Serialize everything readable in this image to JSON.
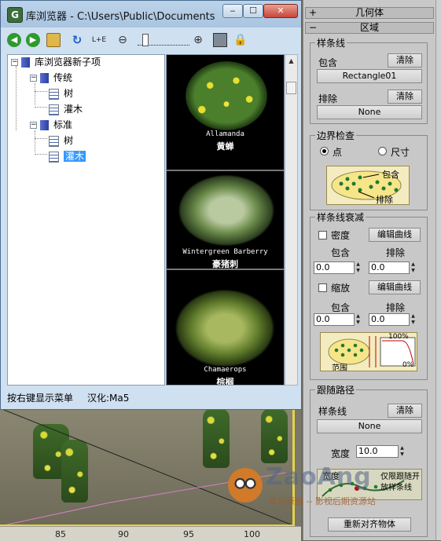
{
  "window": {
    "title": "库浏览器 - C:\\Users\\Public\\Documents\\t...",
    "app_icon": "G",
    "controls": {
      "minimize": "‒",
      "maximize": "☐",
      "close": "✕"
    }
  },
  "toolbar": {
    "icons": [
      "back-icon",
      "forward-icon",
      "folder-up-icon",
      "refresh-icon",
      "le-icon",
      "zoom-out-icon",
      "zoom-slider",
      "zoom-in-icon",
      "save-icon",
      "lock-icon"
    ],
    "le_label": "L+E"
  },
  "tree": {
    "root": "库浏览器新子项",
    "groups": [
      {
        "label": "传统",
        "items": [
          "树",
          "灌木"
        ]
      },
      {
        "label": "标准",
        "items": [
          "树",
          "灌木"
        ]
      }
    ],
    "selected": "灌木"
  },
  "preview": {
    "items": [
      {
        "name_en": "Allamanda",
        "name_cn": "黄蝉"
      },
      {
        "name_en": "Wintergreen Barberry",
        "name_cn": "豪猪刺"
      },
      {
        "name_en": "Chamaerops",
        "name_cn": "棕榈"
      }
    ]
  },
  "status": {
    "hint": "按右键显示菜单",
    "credit": "汉化:Ma5"
  },
  "ruler": {
    "ticks": [
      "85",
      "90",
      "95",
      "100"
    ]
  },
  "panel": {
    "rollout_geometry": {
      "sign": "+",
      "title": "几何体"
    },
    "rollout_region": {
      "sign": "−",
      "title": "区域"
    },
    "spline": {
      "title": "样条线",
      "include_label": "包含",
      "include_clear": "清除",
      "include_value": "Rectangle01",
      "exclude_label": "排除",
      "exclude_clear": "清除",
      "exclude_value": "None"
    },
    "bounds": {
      "title": "边界检查",
      "opt_point": "点",
      "opt_size": "尺寸",
      "diagram_include": "包含",
      "diagram_exclude": "排除"
    },
    "falloff": {
      "title": "样条线衰减",
      "density_label": "密度",
      "density_edit": "编辑曲线",
      "include_label": "包含",
      "exclude_label": "排除",
      "density_include": "0.0",
      "density_exclude": "0.0",
      "scale_label": "缩放",
      "scale_edit": "编辑曲线",
      "scale_include_label": "包含",
      "scale_exclude_label": "排除",
      "scale_include": "0.0",
      "scale_exclude": "0.0",
      "diagram_range": "范围",
      "diagram_pct_top": "100%",
      "diagram_pct_bottom": "0%"
    },
    "follow": {
      "title": "跟随路径",
      "spline_label": "样条线",
      "spline_clear": "清除",
      "spline_value": "None",
      "width_label": "宽度",
      "width_value": "10.0",
      "diagram_width": "宽度",
      "diagram_note1": "仅限跟随开",
      "diagram_note2": "放样条线",
      "realign": "重新对齐物体"
    }
  },
  "watermark": {
    "brand": "ZaoAng",
    "tagline": "早昂原创 -- 影视后期资源站"
  },
  "colors": {
    "selection": "#3399ff",
    "viewport_border": "#e5d24a",
    "titlebar": "#bcd3ea"
  }
}
